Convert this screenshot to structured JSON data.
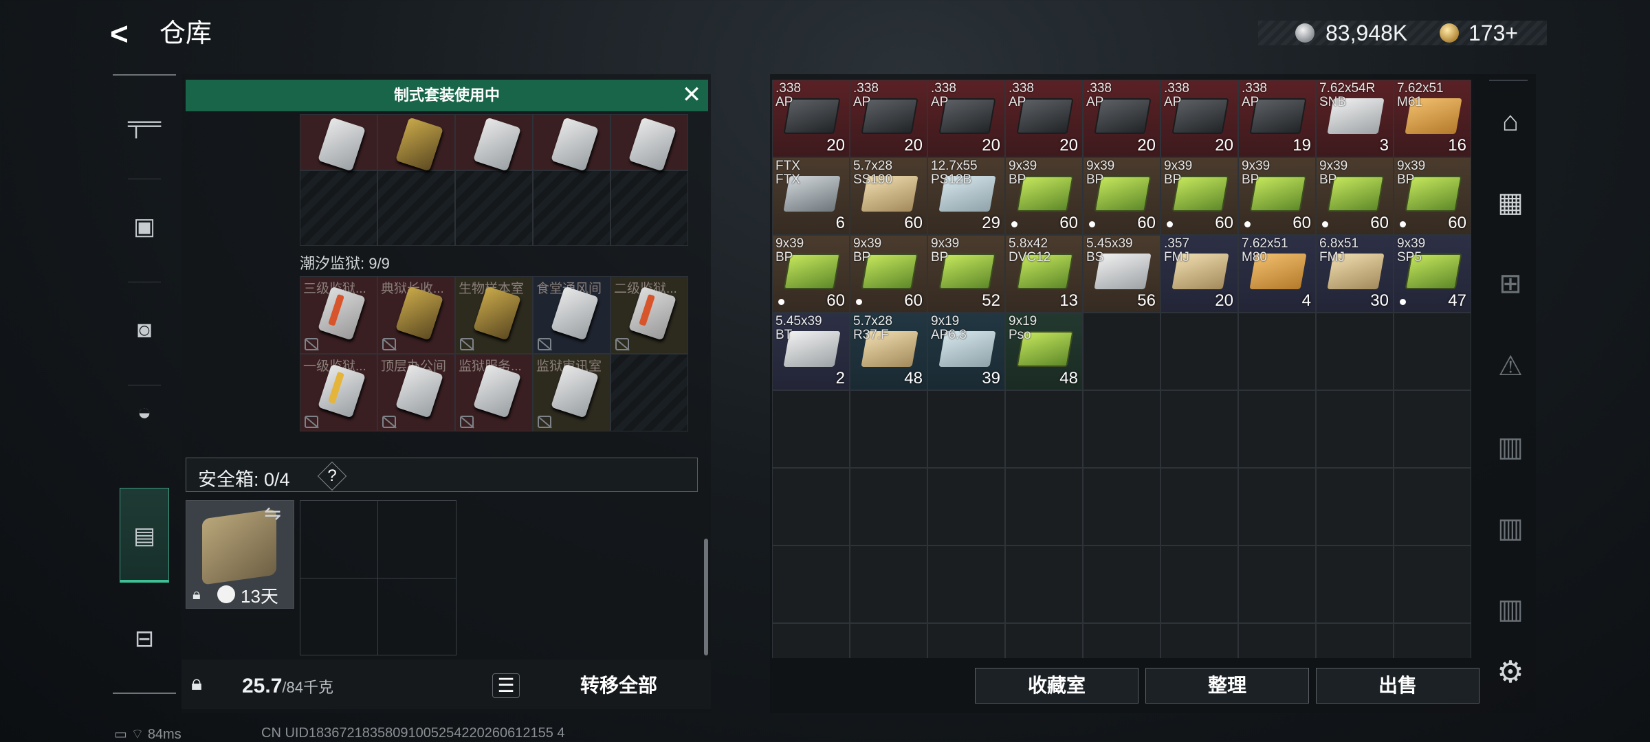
{
  "header": {
    "back_glyph": "<",
    "title": "仓库"
  },
  "currency": {
    "silver": "83,948K",
    "gold": "173+"
  },
  "left_sidebar": {
    "icons": [
      "gun-icon",
      "armor-vest-icon",
      "backpack-icon",
      "helmet-icon",
      "secure-container-icon",
      "toolbox-icon"
    ],
    "selected": "secure-container-icon"
  },
  "banner": {
    "text": "制式套装使用中",
    "close": "✕"
  },
  "keys_section": {
    "label": "潮汐监狱: 9/9",
    "row1": [
      {
        "name": "三级监狱..."
      },
      {
        "name": "典狱长收..."
      },
      {
        "name": "生物样本室"
      },
      {
        "name": "食堂通风间"
      },
      {
        "name": "二级监狱..."
      }
    ],
    "row2": [
      {
        "name": "一级监狱..."
      },
      {
        "name": "顶层办公间"
      },
      {
        "name": "监狱服务..."
      },
      {
        "name": "监狱审讯室"
      }
    ]
  },
  "safe_box": {
    "label": "安全箱: 0/4",
    "help": "?",
    "days": "13天"
  },
  "bottom_left": {
    "weight": "25.7",
    "weight_max": "/84千克",
    "transfer": "转移全部"
  },
  "stash_items": [
    {
      "name": ".338\nAP",
      "count": "20",
      "bg": "red",
      "box": "ammo"
    },
    {
      "name": ".338\nAP",
      "count": "20",
      "bg": "red",
      "box": "ammo"
    },
    {
      "name": ".338\nAP",
      "count": "20",
      "bg": "red",
      "box": "ammo"
    },
    {
      "name": ".338\nAP",
      "count": "20",
      "bg": "red",
      "box": "ammo"
    },
    {
      "name": ".338\nAP",
      "count": "20",
      "bg": "red",
      "box": "ammo"
    },
    {
      "name": ".338\nAP",
      "count": "20",
      "bg": "red",
      "box": "ammo"
    },
    {
      "name": ".338\nAP",
      "count": "19",
      "bg": "red",
      "box": "ammo"
    },
    {
      "name": "7.62x54R\nSNB",
      "count": "3",
      "bg": "red",
      "box": "white"
    },
    {
      "name": "7.62x51\nM61",
      "count": "16",
      "bg": "red",
      "box": "orange"
    },
    {
      "name": "FTX\nFTX",
      "count": "6",
      "bg": "brown",
      "box": "grey"
    },
    {
      "name": "5.7x28\nSS190",
      "count": "60",
      "bg": "brown",
      "box": "tan"
    },
    {
      "name": "12.7x55\nPS12B",
      "count": "29",
      "bg": "brown",
      "box": "pale"
    },
    {
      "name": "9x39\nBP",
      "count": "60",
      "bg": "brown",
      "box": "green",
      "dot": true
    },
    {
      "name": "9x39\nBP",
      "count": "60",
      "bg": "brown",
      "box": "green",
      "dot": true
    },
    {
      "name": "9x39\nBP",
      "count": "60",
      "bg": "brown",
      "box": "green",
      "dot": true
    },
    {
      "name": "9x39\nBP",
      "count": "60",
      "bg": "brown",
      "box": "green",
      "dot": true
    },
    {
      "name": "9x39\nBP",
      "count": "60",
      "bg": "brown",
      "box": "green",
      "dot": true
    },
    {
      "name": "9x39\nBP",
      "count": "60",
      "bg": "brown",
      "box": "green",
      "dot": true
    },
    {
      "name": "9x39\nBP",
      "count": "60",
      "bg": "brown",
      "box": "green",
      "dot": true
    },
    {
      "name": "9x39\nBP",
      "count": "60",
      "bg": "brown",
      "box": "green",
      "dot": true
    },
    {
      "name": "9x39\nBP",
      "count": "52",
      "bg": "brown",
      "box": "green"
    },
    {
      "name": "5.8x42\nDVC12",
      "count": "13",
      "bg": "brown",
      "box": "green"
    },
    {
      "name": "5.45x39\nBS",
      "count": "56",
      "bg": "brown",
      "box": "white"
    },
    {
      "name": ".357\nFMJ",
      "count": "20",
      "bg": "blue",
      "box": "tan"
    },
    {
      "name": "7.62x51\nM80",
      "count": "4",
      "bg": "blue",
      "box": "orange"
    },
    {
      "name": "6.8x51\nFMJ",
      "count": "30",
      "bg": "blue",
      "box": "tan"
    },
    {
      "name": "9x39\nSP5",
      "count": "47",
      "bg": "blue",
      "box": "green",
      "dot": true
    },
    {
      "name": "5.45x39\nBT",
      "count": "2",
      "bg": "blue",
      "box": "white"
    },
    {
      "name": "5.7x28\nR37.F",
      "count": "48",
      "bg": "teal",
      "box": "tan"
    },
    {
      "name": "9x19\nAP6.3",
      "count": "39",
      "bg": "teal",
      "box": "pale"
    },
    {
      "name": "9x19\nPso",
      "count": "48",
      "bg": "green",
      "box": "green"
    }
  ],
  "right_sidebar": {
    "icons": [
      "collection-room-icon",
      "level4-card-icon",
      "level4-card-plus-icon",
      "level4-card-warning-icon",
      "level4-card-key-icon",
      "level4-card-key2-icon",
      "level4-card-key3-icon"
    ]
  },
  "bottom_right": {
    "collection": "收藏室",
    "sort": "整理",
    "sell": "出售"
  },
  "status": {
    "ping": "84ms",
    "uid": "CN UID18367218358091005254220260612155 4"
  }
}
